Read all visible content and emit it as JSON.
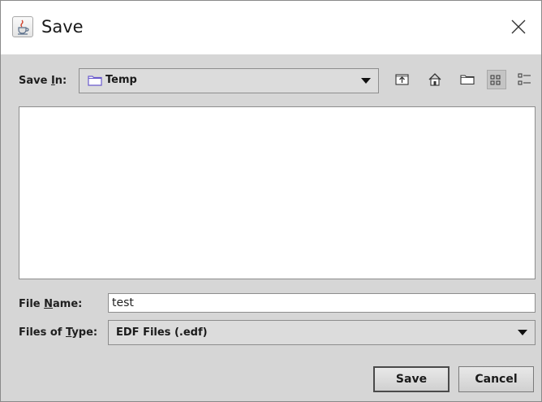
{
  "window": {
    "title": "Save",
    "app_icon": "java-cup-icon",
    "close_icon": "close-icon"
  },
  "save_in": {
    "label_prefix": "Save ",
    "label_mnemonic": "I",
    "label_suffix": "n:",
    "value": "Temp",
    "icon": "folder-icon"
  },
  "toolbar": [
    {
      "name": "up-one-level-button",
      "icon": "up-folder-icon"
    },
    {
      "name": "home-button",
      "icon": "home-icon"
    },
    {
      "name": "new-folder-button",
      "icon": "new-folder-icon"
    },
    {
      "name": "list-view-button",
      "icon": "list-view-icon",
      "selected": true
    },
    {
      "name": "details-view-button",
      "icon": "details-view-icon",
      "selected": false
    }
  ],
  "file_list": {
    "items": []
  },
  "file_name": {
    "label_prefix": "File ",
    "label_mnemonic": "N",
    "label_suffix": "ame:",
    "value": "test"
  },
  "file_type": {
    "label_prefix": "Files of ",
    "label_mnemonic": "T",
    "label_suffix": "ype:",
    "value": "EDF Files (.edf)"
  },
  "buttons": {
    "save": "Save",
    "cancel": "Cancel"
  },
  "colors": {
    "dialog_bg": "#d6d6d6",
    "title_bg": "#ffffff",
    "folder_accent": "#6a5acd"
  }
}
